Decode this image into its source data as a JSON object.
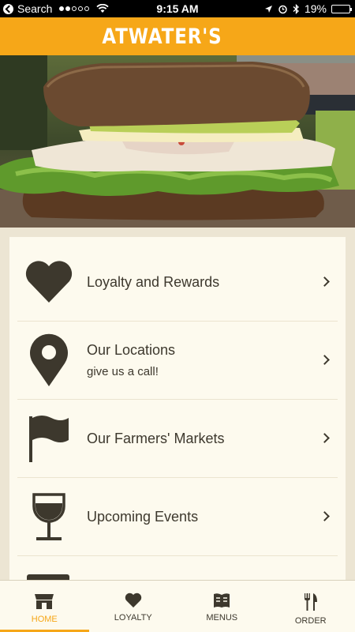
{
  "status_bar": {
    "back_label": "Search",
    "time": "9:15 AM",
    "battery": "19%",
    "battery_level": 0.19,
    "signal_bars": 2
  },
  "header": {
    "logo_text": "ATWATER'S"
  },
  "hero": {
    "icon": "sandwich-photo"
  },
  "menu": {
    "items": [
      {
        "title": "Loyalty and Rewards",
        "subtitle": "",
        "icon": "heart-icon"
      },
      {
        "title": "Our Locations",
        "subtitle": "give us a call!",
        "icon": "map-pin-icon"
      },
      {
        "title": "Our Farmers' Markets",
        "subtitle": "",
        "icon": "flag-icon"
      },
      {
        "title": "Upcoming Events",
        "subtitle": "",
        "icon": "wine-glass-icon"
      }
    ]
  },
  "tabbar": {
    "tabs": [
      {
        "label": "HOME",
        "icon": "storefront-icon",
        "active": true
      },
      {
        "label": "LOYALTY",
        "icon": "heart-icon",
        "active": false
      },
      {
        "label": "MENUS",
        "icon": "book-icon",
        "active": false
      },
      {
        "label": "ORDER",
        "icon": "fork-knife-icon",
        "active": false
      }
    ]
  },
  "colors": {
    "accent": "#f6a718",
    "text": "#3d382d",
    "card": "#fdfaee",
    "background": "#ece5d3"
  }
}
